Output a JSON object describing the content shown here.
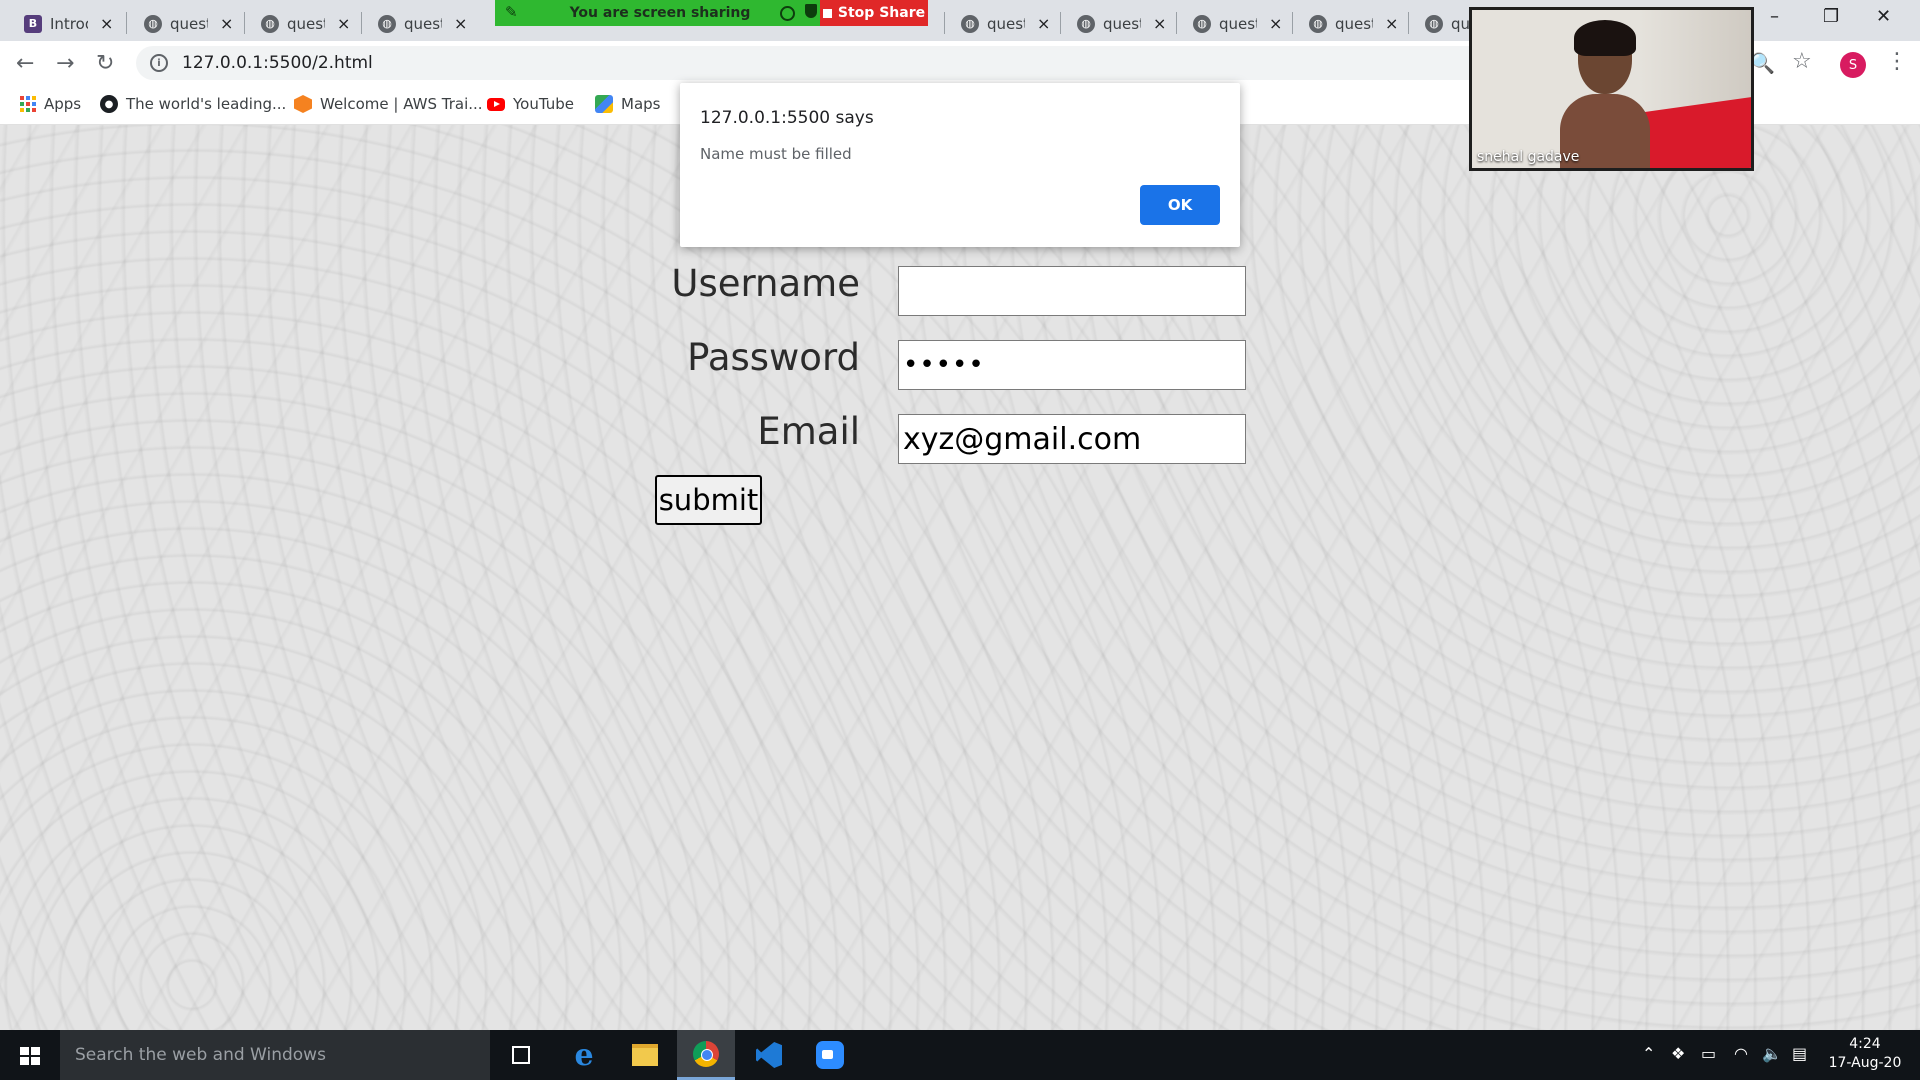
{
  "browser": {
    "tabs": [
      {
        "title": "Introd",
        "favicon": "bootstrap-icon"
      },
      {
        "title": "quest",
        "favicon": "globe-icon"
      },
      {
        "title": "quest",
        "favicon": "globe-icon"
      },
      {
        "title": "quest",
        "favicon": "globe-icon"
      },
      {
        "title": "quest",
        "favicon": "globe-icon"
      },
      {
        "title": "quest",
        "favicon": "globe-icon"
      },
      {
        "title": "quest",
        "favicon": "globe-icon"
      },
      {
        "title": "quest",
        "favicon": "globe-icon"
      },
      {
        "title": "qu",
        "favicon": "globe-icon"
      }
    ],
    "close_glyph": "×",
    "screen_share": {
      "banner_text": "You are screen sharing",
      "stop_label": "Stop Share"
    },
    "window_controls": {
      "minimize": "–",
      "restore": "❐",
      "close": "✕"
    },
    "url": "127.0.0.1:5500/2.html",
    "profile_initial": "S",
    "bookmarks": [
      {
        "label": "Apps",
        "icon": "apps-grid-icon"
      },
      {
        "label": "The world's leading...",
        "icon": "github-icon"
      },
      {
        "label": "Welcome | AWS Trai...",
        "icon": "aws-icon"
      },
      {
        "label": "YouTube",
        "icon": "youtube-icon"
      },
      {
        "label": "Maps",
        "icon": "maps-icon"
      }
    ]
  },
  "dialog": {
    "title": "127.0.0.1:5500 says",
    "message": "Name must be filled",
    "ok_label": "OK",
    "accent": "#1a73e8"
  },
  "form": {
    "username_label": "Username",
    "username_value": "",
    "password_label": "Password",
    "password_value": "•••••",
    "email_label": "Email",
    "email_value": "xyz@gmail.com",
    "submit_label": "submit"
  },
  "video": {
    "participant_name": "snehal gadave"
  },
  "taskbar": {
    "search_placeholder": "Search the web and Windows",
    "time": "4:24",
    "date": "17-Aug-20",
    "apps": [
      "task-view-icon",
      "edge-icon",
      "file-explorer-icon",
      "chrome-icon",
      "vscode-icon",
      "zoom-icon"
    ]
  },
  "colors": {
    "share_green": "#2fb830",
    "stop_red": "#e02828",
    "taskbar": "#101418"
  }
}
